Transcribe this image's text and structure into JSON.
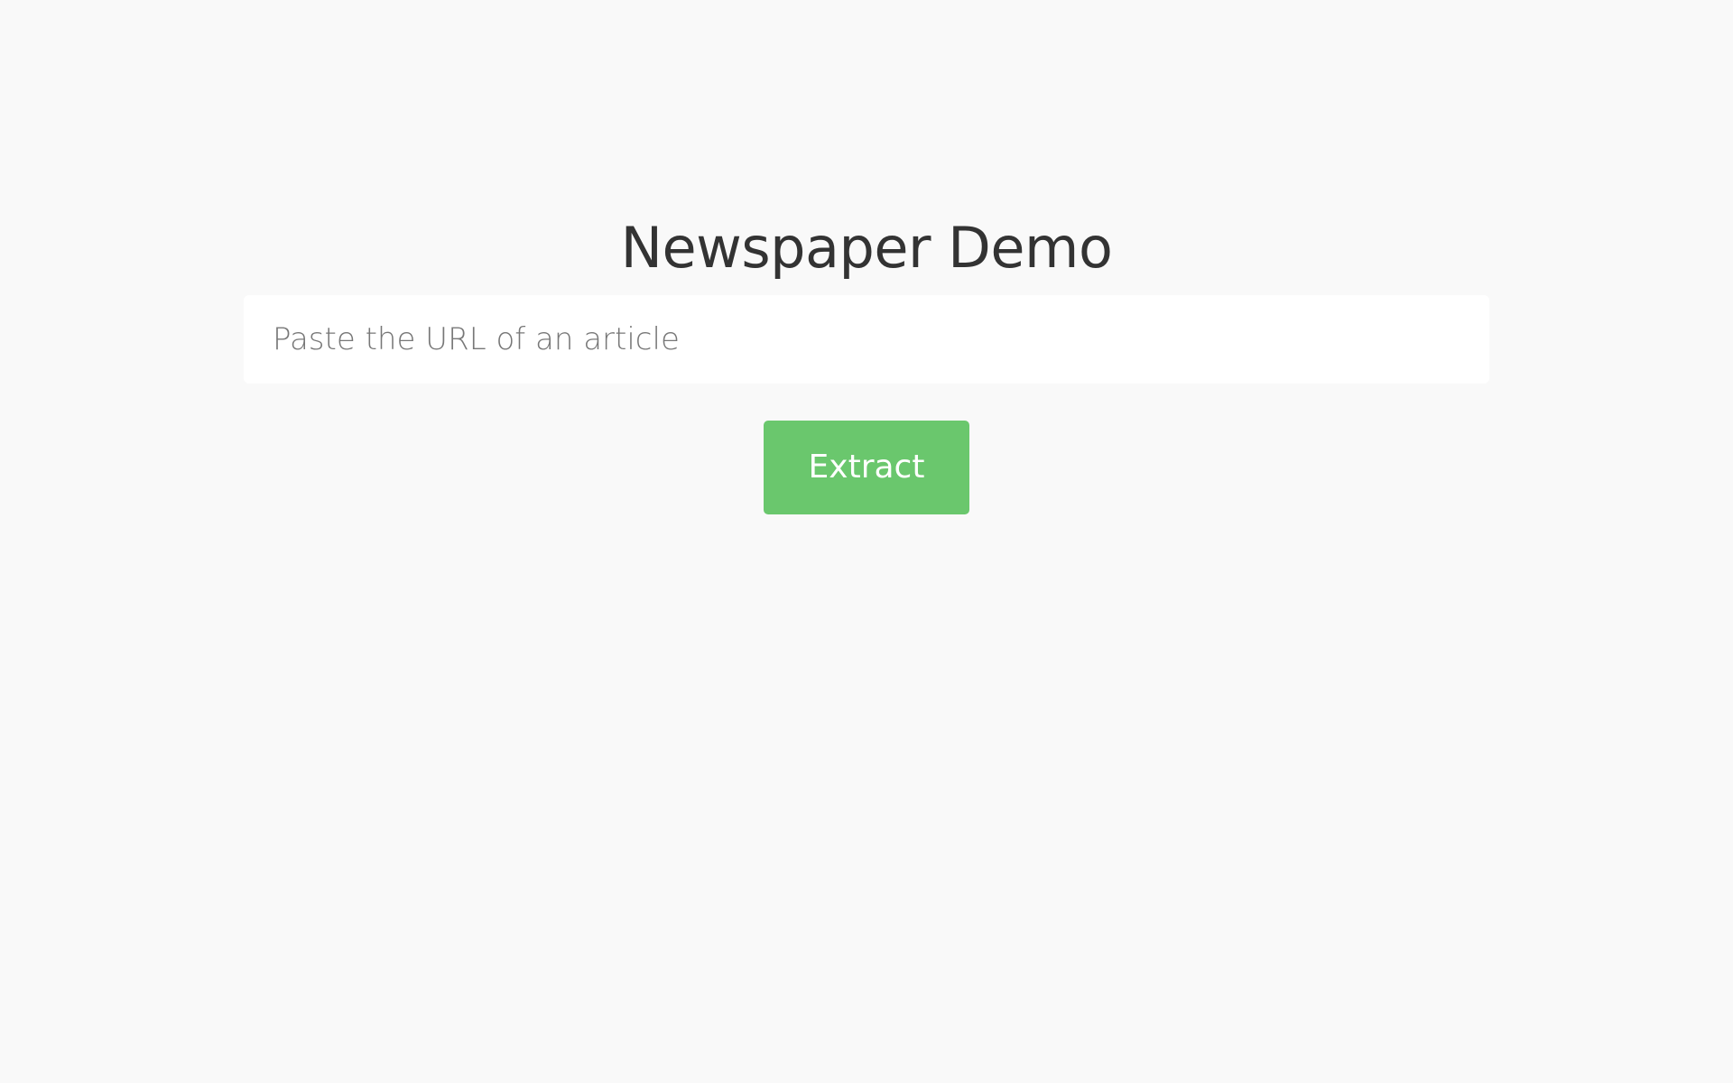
{
  "header": {
    "title": "Newspaper Demo"
  },
  "form": {
    "url_input": {
      "value": "",
      "placeholder": "Paste the URL of an article"
    },
    "extract_label": "Extract"
  },
  "colors": {
    "background": "#f9f9f9",
    "title_text": "#333333",
    "input_background": "#ffffff",
    "placeholder_text": "#777777",
    "button_background": "#6ac76d",
    "button_text": "#ffffff"
  }
}
